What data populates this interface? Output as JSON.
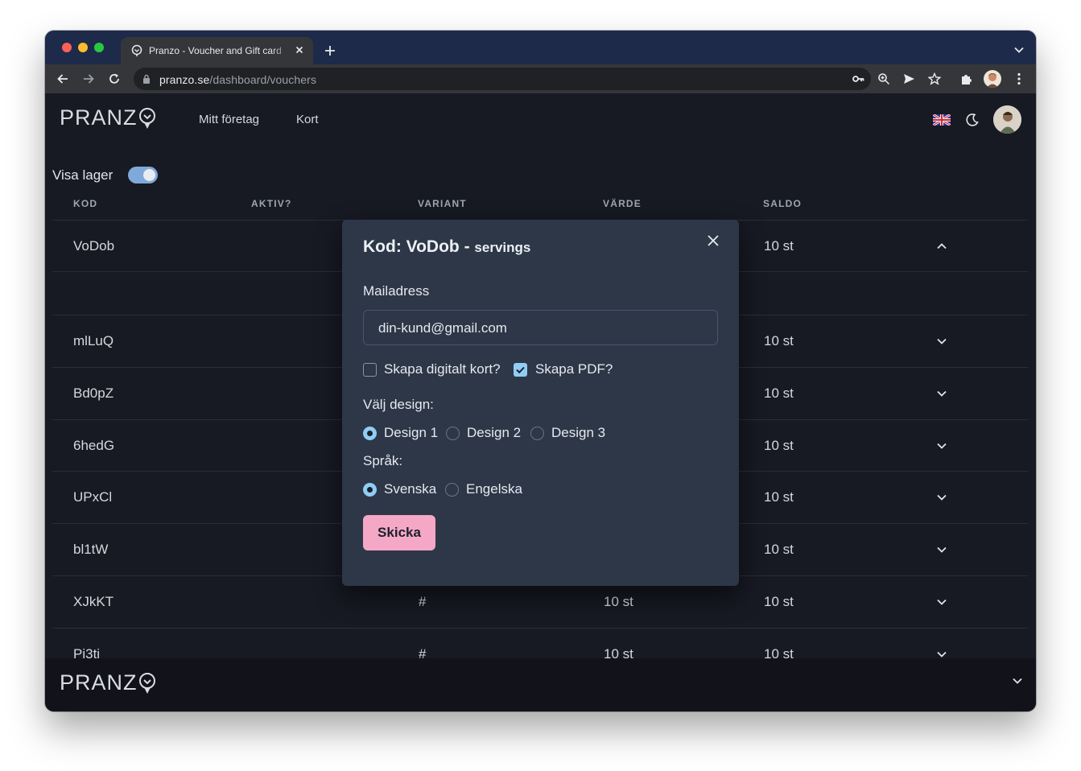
{
  "browser": {
    "tab_title": "Pranzo - Voucher and Gift card",
    "url_domain": "pranzo.se",
    "url_path": "/dashboard/vouchers"
  },
  "app": {
    "logo_text": "PRANZ",
    "nav": [
      "Mitt företag",
      "Kort"
    ],
    "show_stock_label": "Visa lager",
    "show_stock_on": true,
    "columns": [
      "KOD",
      "AKTIV?",
      "VARIANT",
      "VÄRDE",
      "SALDO"
    ],
    "rows": [
      {
        "code": "VoDob",
        "variant": "",
        "value": "",
        "balance": "10 st",
        "expanded": true
      },
      {
        "code": "mlLuQ",
        "variant": "",
        "value": "",
        "balance": "10 st"
      },
      {
        "code": "Bd0pZ",
        "variant": "",
        "value": "",
        "balance": "10 st"
      },
      {
        "code": "6hedG",
        "variant": "",
        "value": "",
        "balance": "10 st"
      },
      {
        "code": "UPxCl",
        "variant": "",
        "value": "",
        "balance": "10 st"
      },
      {
        "code": "bl1tW",
        "variant": "",
        "value": "",
        "balance": "10 st"
      },
      {
        "code": "XJkKT",
        "variant": "#",
        "value": "10 st",
        "balance": "10 st"
      },
      {
        "code": "Pi3ti",
        "variant": "#",
        "value": "10 st",
        "balance": "10 st"
      }
    ]
  },
  "modal": {
    "title": "Kod: VoDob - ",
    "title_sub": "servings",
    "email_label": "Mailadress",
    "email_value": "din-kund@gmail.com",
    "digital_card_label": "Skapa digitalt kort?",
    "digital_card_checked": false,
    "pdf_label": "Skapa PDF?",
    "pdf_checked": true,
    "design_label": "Välj design:",
    "designs": [
      "Design 1",
      "Design 2",
      "Design 3"
    ],
    "selected_design": "Design 1",
    "language_label": "Språk:",
    "languages": [
      "Svenska",
      "Engelska"
    ],
    "selected_language": "Svenska",
    "submit_label": "Skicka"
  },
  "colors": {
    "background": "#171923",
    "modal": "#2d3748",
    "accent_blue": "#90cdf4",
    "button_pink": "#f5a8c5"
  }
}
